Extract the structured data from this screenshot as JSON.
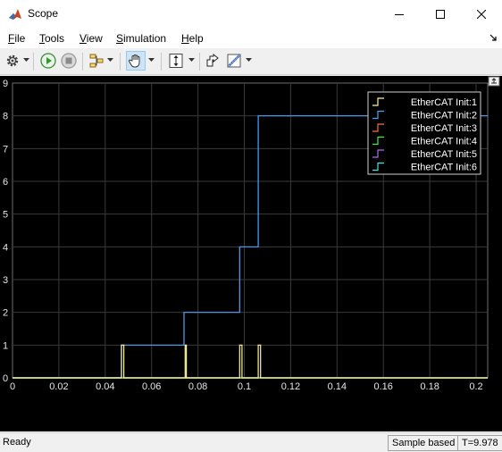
{
  "window": {
    "title": "Scope"
  },
  "menu": [
    {
      "label": "File",
      "ul": "F",
      "rest": "ile"
    },
    {
      "label": "Tools",
      "ul": "T",
      "rest": "ools"
    },
    {
      "label": "View",
      "ul": "V",
      "rest": "iew"
    },
    {
      "label": "Simulation",
      "ul": "S",
      "rest": "imulation"
    },
    {
      "label": "Help",
      "ul": "H",
      "rest": "elp"
    }
  ],
  "toolbar": {
    "icons": [
      "gear-icon",
      "run-icon",
      "stop-icon",
      "signal-selector-icon",
      "pan-hand-icon",
      "zoom-axes-icon",
      "restore-style-icon",
      "measure-icon"
    ],
    "pan_active": true
  },
  "status": {
    "ready": "Ready",
    "sample": "Sample based",
    "time": "T=9.978"
  },
  "colors": {
    "background": "#000000",
    "grid": "#3a3a3a",
    "axis_text": "#e6e6e6",
    "series": [
      "#fff799",
      "#4fa4ff",
      "#ff6b3d",
      "#3df23d",
      "#b366ff",
      "#3fe6e6"
    ]
  },
  "chart_data": {
    "type": "line",
    "xlim": [
      0,
      0.205
    ],
    "ylim": [
      0,
      9
    ],
    "x_ticks": [
      "0",
      "0.02",
      "0.04",
      "0.06",
      "0.08",
      "0.1",
      "0.12",
      "0.14",
      "0.16",
      "0.18",
      "0.2"
    ],
    "y_ticks": [
      "0",
      "1",
      "2",
      "3",
      "4",
      "5",
      "6",
      "7",
      "8",
      "9"
    ],
    "grid": true,
    "legend_position": "top-right",
    "series": [
      {
        "name": "EtherCAT Init:1",
        "x": [
          0,
          0.047,
          0.047,
          0.048,
          0.048,
          0.0745,
          0.0745,
          0.075,
          0.075,
          0.098,
          0.098,
          0.099,
          0.099,
          0.106,
          0.106,
          0.107,
          0.107,
          0.205
        ],
        "y": [
          0,
          0,
          1,
          1,
          0,
          0,
          1,
          1,
          0,
          0,
          1,
          1,
          0,
          0,
          1,
          1,
          0,
          0
        ]
      },
      {
        "name": "EtherCAT Init:2",
        "x": [
          0,
          0.047,
          0.047,
          0.074,
          0.074,
          0.098,
          0.098,
          0.106,
          0.106,
          0.205
        ],
        "y": [
          0,
          0,
          1,
          1,
          2,
          2,
          4,
          4,
          8,
          8
        ]
      },
      {
        "name": "EtherCAT Init:3",
        "x": [
          0,
          0.205
        ],
        "y": [
          0,
          0
        ]
      },
      {
        "name": "EtherCAT Init:4",
        "x": [
          0,
          0.205
        ],
        "y": [
          0,
          0
        ]
      },
      {
        "name": "EtherCAT Init:5",
        "x": [
          0,
          0.205
        ],
        "y": [
          0,
          0
        ]
      },
      {
        "name": "EtherCAT Init:6",
        "x": [
          0,
          0.205
        ],
        "y": [
          0,
          0
        ]
      }
    ]
  }
}
